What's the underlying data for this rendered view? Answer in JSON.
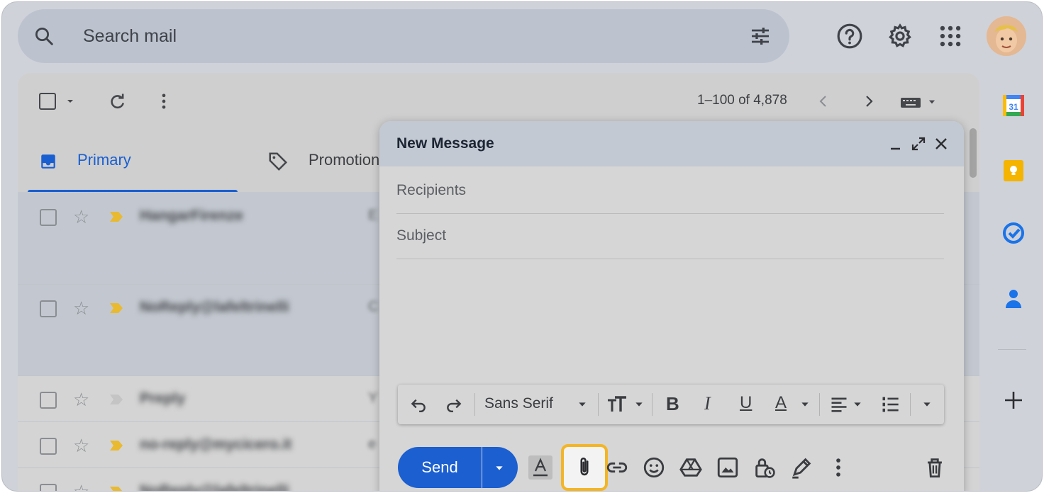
{
  "header": {
    "search_placeholder": "Search mail",
    "icons": [
      "search-icon",
      "tune-icon",
      "help-icon",
      "settings-icon",
      "apps-icon",
      "avatar"
    ]
  },
  "toolbar": {
    "pagination": "1–100 of 4,878",
    "icons": [
      "select-checkbox",
      "chevron-down-icon",
      "refresh-icon",
      "more-vert-icon",
      "chevron-left-icon",
      "chevron-right-icon",
      "keyboard-icon"
    ]
  },
  "tabs": [
    {
      "label": "Primary",
      "active": true
    },
    {
      "label": "Promotions",
      "active": false
    }
  ],
  "emails": [
    {
      "sender": "HangarFirenze",
      "snippet": "E",
      "unread": true
    },
    {
      "sender": "NoReply@lafeltrinelli",
      "snippet": "C",
      "unread": true
    },
    {
      "sender": "Preply",
      "snippet": "Y",
      "unread": false
    },
    {
      "sender": "no-reply@mycicero.it",
      "snippet": "e",
      "unread": false
    },
    {
      "sender": "NoReply@lafeltrinelli",
      "snippet": "",
      "unread": false
    }
  ],
  "compose": {
    "title": "New Message",
    "recipients_placeholder": "Recipients",
    "subject_placeholder": "Subject",
    "font_name": "Sans Serif",
    "send_label": "Send",
    "calendar_day": "31",
    "format_letters": {
      "bold": "B",
      "italic": "I",
      "underline": "U",
      "text_color": "A"
    }
  },
  "colors": {
    "accent": "#1b5fd0",
    "highlight": "#f3b526"
  }
}
